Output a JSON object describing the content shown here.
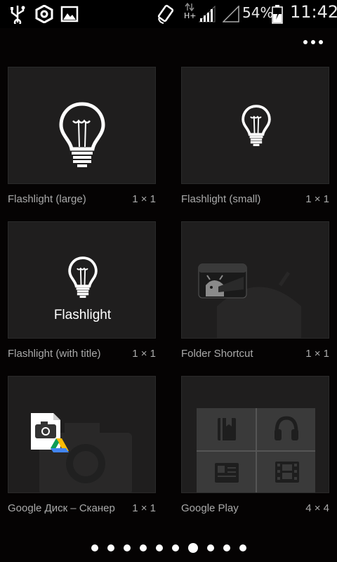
{
  "status": {
    "battery": "54%",
    "time": "11:42",
    "network": "H+"
  },
  "widgets": [
    {
      "name": "Flashlight (large)",
      "size": "1 × 1"
    },
    {
      "name": "Flashlight (small)",
      "size": "1 × 1"
    },
    {
      "name": "Flashlight (with title)",
      "size": "1 × 1",
      "preview_title": "Flashlight"
    },
    {
      "name": "Folder Shortcut",
      "size": "1 × 1"
    },
    {
      "name": "Google Диск – Сканер",
      "size": "1 × 1"
    },
    {
      "name": "Google Play",
      "size": "4 × 4"
    }
  ],
  "pager": {
    "pages": 10,
    "current": 7
  },
  "icons": [
    "usb-icon",
    "settings-hex-icon",
    "gallery-icon",
    "rotate-icon",
    "signal-icon",
    "no-signal-icon",
    "battery-icon",
    "more-icon"
  ]
}
